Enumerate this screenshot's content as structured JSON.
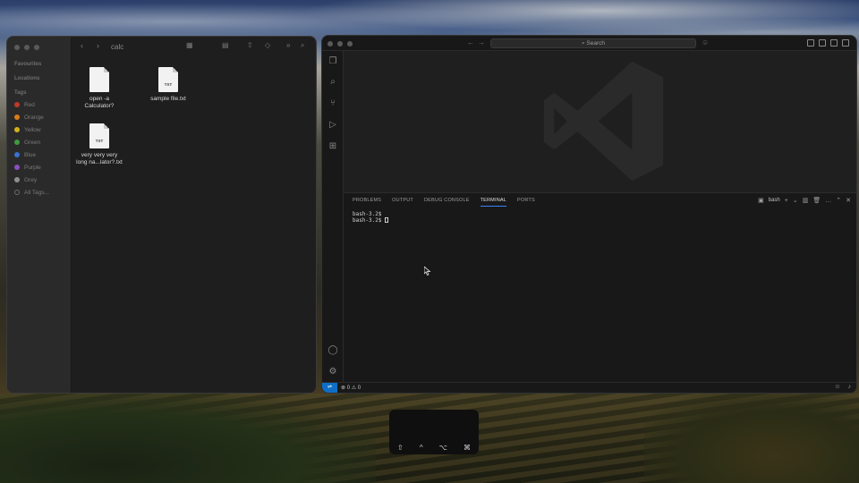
{
  "finder": {
    "title": "calc",
    "sidebar": {
      "favourites": "Favourites",
      "locations": "Locations",
      "tags_header": "Tags",
      "tags": [
        {
          "label": "Red",
          "color": "#c0392b"
        },
        {
          "label": "Orange",
          "color": "#d97c1a"
        },
        {
          "label": "Yellow",
          "color": "#d4b01f"
        },
        {
          "label": "Green",
          "color": "#3f9a3f"
        },
        {
          "label": "Blue",
          "color": "#3b6fd1"
        },
        {
          "label": "Purple",
          "color": "#8a4fc0"
        },
        {
          "label": "Grey",
          "color": "#8e8e8e"
        },
        {
          "label": "All Tags...",
          "color": ""
        }
      ]
    },
    "files": [
      {
        "name_line1": "open -a",
        "name_line2": "Calculator?",
        "ext": ""
      },
      {
        "name_line1": "sample file.txt",
        "name_line2": "",
        "ext": "TXT"
      },
      {
        "name_line1": "very very very",
        "name_line2": "long na...lator?.txt",
        "ext": "TXT"
      }
    ]
  },
  "vscode": {
    "search_placeholder": "Search",
    "panel_tabs": [
      {
        "label": "PROBLEMS",
        "active": false
      },
      {
        "label": "OUTPUT",
        "active": false
      },
      {
        "label": "DEBUG CONSOLE",
        "active": false
      },
      {
        "label": "TERMINAL",
        "active": true
      },
      {
        "label": "PORTS",
        "active": false
      }
    ],
    "terminal_name": "bash",
    "terminal_lines": [
      "bash-3.2$",
      "bash-3.2$"
    ],
    "status": {
      "errors": "0",
      "warnings": "0"
    },
    "accent": "#3b82f6",
    "remote_color": "#0e6fc5"
  },
  "keys": {
    "labels": [
      "⇧",
      "^",
      "⌥",
      "⌘"
    ]
  }
}
